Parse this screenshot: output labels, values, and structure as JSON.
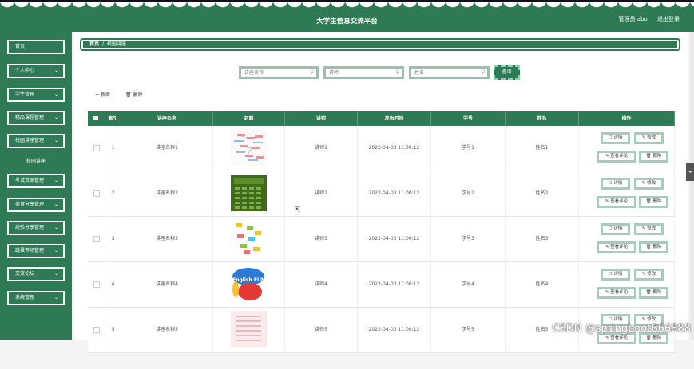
{
  "header": {
    "title": "大学生信息交流平台",
    "user_label": "管理员 abo",
    "logout": "退出登录"
  },
  "sidebar": {
    "items": [
      {
        "label": "首页",
        "chevron": false
      },
      {
        "label": "个人中心",
        "chevron": true
      },
      {
        "label": "学生管理",
        "chevron": true
      },
      {
        "label": "精品课程管理",
        "chevron": true
      },
      {
        "label": "校园讲座管理",
        "chevron": true
      },
      {
        "label": "考试资源管理",
        "chevron": true
      },
      {
        "label": "美食分享管理",
        "chevron": true
      },
      {
        "label": "经验分享管理",
        "chevron": true
      },
      {
        "label": "跳蚤市场管理",
        "chevron": true
      },
      {
        "label": "交流论坛",
        "chevron": true
      },
      {
        "label": "系统管理",
        "chevron": true
      }
    ],
    "subitem": "校园讲座"
  },
  "breadcrumb": {
    "home": "首页",
    "sep": "/",
    "current": "校园讲座"
  },
  "search": {
    "name_placeholder": "讲座名称",
    "teacher_placeholder": "讲师",
    "student_placeholder": "姓名",
    "button": "查询"
  },
  "actions": {
    "add": "+ 新增",
    "delete": "删除"
  },
  "table": {
    "headers": [
      "",
      "索引",
      "讲座名称",
      "封面",
      "讲师",
      "发布时间",
      "学号",
      "姓名",
      "操作"
    ],
    "rows": [
      {
        "index": "1",
        "name": "讲座名称1",
        "teacher": "讲师1",
        "time": "2022-04-03 11:00:12",
        "sid": "学号1",
        "sname": "姓名1"
      },
      {
        "index": "2",
        "name": "讲座名称2",
        "teacher": "讲师2",
        "time": "2022-04-03 11:00:12",
        "sid": "学号2",
        "sname": "姓名2"
      },
      {
        "index": "3",
        "name": "讲座名称3",
        "teacher": "讲师3",
        "time": "2022-04-03 11:00:12",
        "sid": "学号3",
        "sname": "姓名3"
      },
      {
        "index": "4",
        "name": "讲座名称4",
        "teacher": "讲师4",
        "time": "2022-04-03 11:00:12",
        "sid": "学号4",
        "sname": "姓名4"
      },
      {
        "index": "5",
        "name": "讲座名称5",
        "teacher": "讲师5",
        "time": "2022-04-03 11:00:12",
        "sid": "学号5",
        "sname": "姓名5"
      }
    ],
    "ops": {
      "detail": "详情",
      "edit": "修改",
      "review": "查看评论",
      "del": "删除"
    }
  },
  "cover4_text": "English FUN",
  "watermark": "CSDN @springboot666888",
  "colors": {
    "primary": "#2d7a55",
    "border": "#a9cbbc"
  }
}
